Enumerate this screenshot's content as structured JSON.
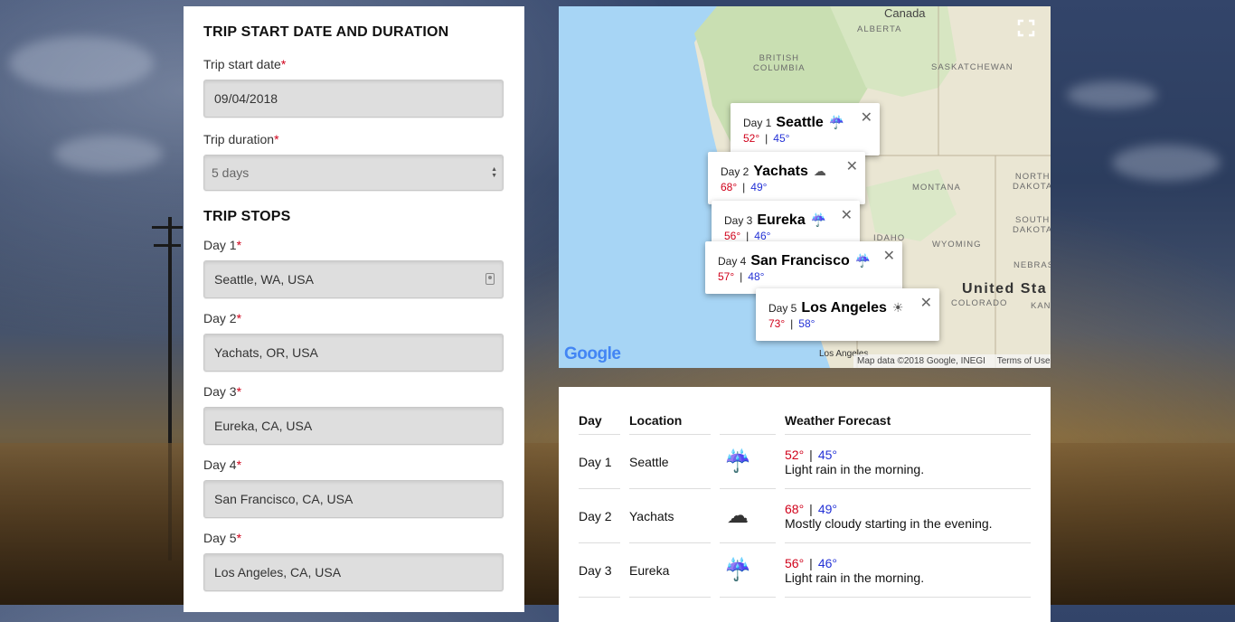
{
  "form": {
    "section_title": "TRIP START DATE AND DURATION",
    "start_date_label": "Trip start date",
    "start_date_value": "09/04/2018",
    "duration_label": "Trip duration",
    "duration_value": "5 days",
    "required_mark": "*",
    "stops_title": "TRIP STOPS",
    "stops": [
      {
        "label": "Day 1",
        "value": "Seattle, WA, USA"
      },
      {
        "label": "Day 2",
        "value": "Yachats, OR, USA"
      },
      {
        "label": "Day 3",
        "value": "Eureka, CA, USA"
      },
      {
        "label": "Day 4",
        "value": "San Francisco, CA, USA"
      },
      {
        "label": "Day 5",
        "value": "Los Angeles, CA, USA"
      }
    ]
  },
  "map": {
    "labels": {
      "alberta": "ALBERTA",
      "british_columbia": "BRITISH\nCOLUMBIA",
      "saskatchewan": "SASKATCHEWAN",
      "montana": "MONTANA",
      "north_dakota": "NORTH\nDAKOTA",
      "south_dakota": "SOUTH\nDAKOTA",
      "idaho": "IDAHO",
      "wyoming": "WYOMING",
      "nebraska": "NEBRAS",
      "united_states": "United Sta",
      "colorado": "COLORADO",
      "kansas": "KAN",
      "los_angeles": "Los Angeles",
      "canada": "Canada"
    },
    "google_logo": "Google",
    "attribution": "Map data ©2018 Google, INEGI",
    "terms": "Terms of Use",
    "popups": [
      {
        "day": "Day 1",
        "city": "Seattle",
        "hi": "52°",
        "lo": "45°",
        "icon": "rain-icon"
      },
      {
        "day": "Day 2",
        "city": "Yachats",
        "hi": "68°",
        "lo": "49°",
        "icon": "partly-cloudy-night-icon"
      },
      {
        "day": "Day 3",
        "city": "Eureka",
        "hi": "56°",
        "lo": "46°",
        "icon": "rain-icon"
      },
      {
        "day": "Day 4",
        "city": "San Francisco",
        "hi": "57°",
        "lo": "48°",
        "icon": "rain-icon"
      },
      {
        "day": "Day 5",
        "city": "Los Angeles",
        "hi": "73°",
        "lo": "58°",
        "icon": "sun-icon"
      }
    ],
    "separator": "|",
    "close_glyph": "✕"
  },
  "forecast": {
    "headers": {
      "day": "Day",
      "location": "Location",
      "weather": "Weather Forecast"
    },
    "rows": [
      {
        "day": "Day 1",
        "location": "Seattle",
        "hi": "52°",
        "lo": "45°",
        "summary": "Light rain in the morning.",
        "icon": "rain-icon"
      },
      {
        "day": "Day 2",
        "location": "Yachats",
        "hi": "68°",
        "lo": "49°",
        "summary": "Mostly cloudy starting in the evening.",
        "icon": "partly-cloudy-night-icon"
      },
      {
        "day": "Day 3",
        "location": "Eureka",
        "hi": "56°",
        "lo": "46°",
        "summary": "Light rain in the morning.",
        "icon": "rain-icon"
      }
    ]
  },
  "colors": {
    "high_temp": "#d0021b",
    "low_temp": "#2432d6",
    "required": "#d0021b"
  }
}
